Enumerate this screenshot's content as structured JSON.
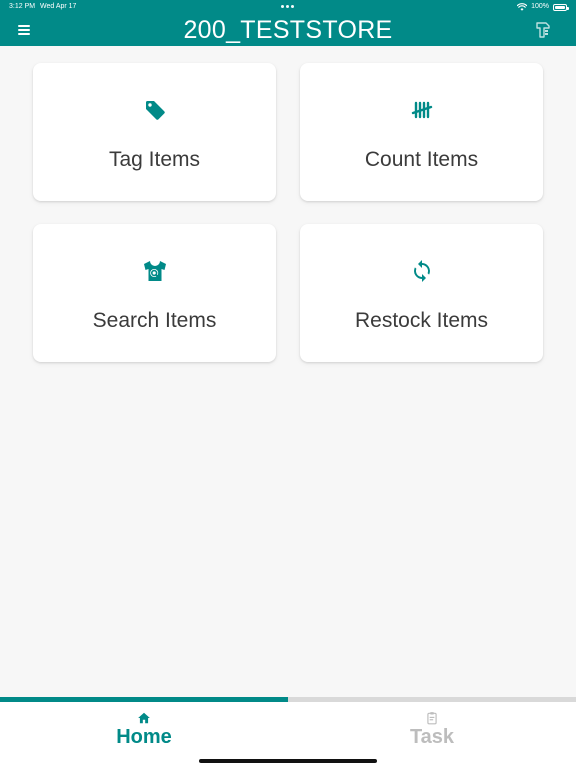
{
  "status_bar": {
    "time": "3:12 PM",
    "date": "Wed Apr 17",
    "battery": "100%"
  },
  "app_bar": {
    "title": "200_TESTSTORE",
    "menu_icon": "menu-icon",
    "right_icon": "scanner-icon"
  },
  "tiles": [
    {
      "label": "Tag Items",
      "icon": "tag-icon"
    },
    {
      "label": "Count Items",
      "icon": "tally-icon"
    },
    {
      "label": "Search Items",
      "icon": "shirt-search-icon"
    },
    {
      "label": "Restock Items",
      "icon": "refresh-icon"
    }
  ],
  "bottom_nav": {
    "selected_index": 0,
    "items": [
      {
        "label": "Home",
        "icon": "home-icon"
      },
      {
        "label": "Task",
        "icon": "clipboard-icon"
      }
    ],
    "progress_fraction": 0.5
  },
  "colors": {
    "primary": "#018a88",
    "background": "#f7f7f7",
    "inactive": "#bdbdbd"
  }
}
